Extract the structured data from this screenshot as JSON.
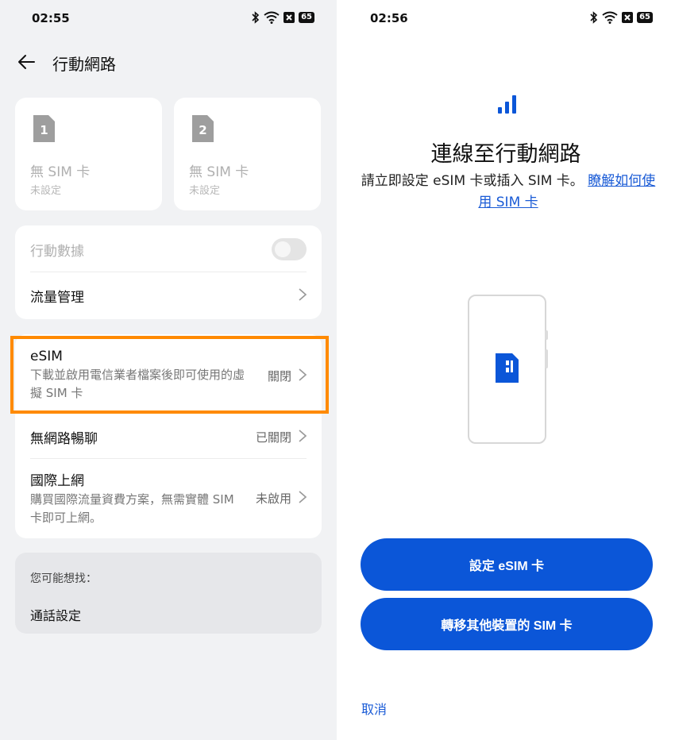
{
  "left": {
    "status": {
      "time": "02:55",
      "battery": "65"
    },
    "title": "行動網路",
    "sims": [
      {
        "number": "1",
        "name": "無 SIM 卡",
        "status": "未設定"
      },
      {
        "number": "2",
        "name": "無 SIM 卡",
        "status": "未設定"
      }
    ],
    "mobile_data": {
      "label": "行動數據",
      "enabled": false
    },
    "usage": {
      "label": "流量管理"
    },
    "esim": {
      "label": "eSIM",
      "description": "下載並啟用電信業者檔案後即可使用的虛擬 SIM 卡",
      "value": "關閉"
    },
    "offline_chat": {
      "label": "無網路暢聊",
      "value": "已關閉"
    },
    "roaming": {
      "label": "國際上網",
      "description": "購買國際流量資費方案，無需實體 SIM 卡即可上網。",
      "value": "未啟用"
    },
    "suggestions": {
      "label": "您可能想找：",
      "items": [
        "通話設定"
      ]
    }
  },
  "right": {
    "status": {
      "time": "02:56",
      "battery": "65"
    },
    "title": "連線至行動網路",
    "description": "請立即設定 eSIM 卡或插入 SIM 卡。",
    "link": "瞭解如何使用 SIM 卡",
    "setup_button": "設定 eSIM 卡",
    "transfer_button": "轉移其他裝置的 SIM 卡",
    "cancel": "取消",
    "colors": {
      "accent": "#0b56d8",
      "highlight": "#ff8a00"
    }
  }
}
